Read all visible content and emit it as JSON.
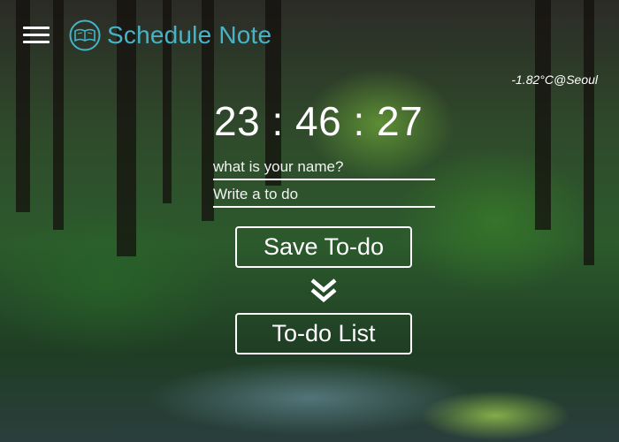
{
  "header": {
    "title": "Schedule Note",
    "menu_icon": "hamburger-menu-icon",
    "logo_icon": "book-logo-icon",
    "title_color": "#45b4c9"
  },
  "weather": {
    "text": "-1.82°C@Seoul"
  },
  "clock": {
    "time": "23 : 46 : 27"
  },
  "form": {
    "name_placeholder": "what is your name?",
    "todo_placeholder": "Write a to do",
    "save_label": "Save To-do"
  },
  "todo_list": {
    "toggle_icon": "double-chevron-down-icon",
    "label": "To-do List"
  }
}
